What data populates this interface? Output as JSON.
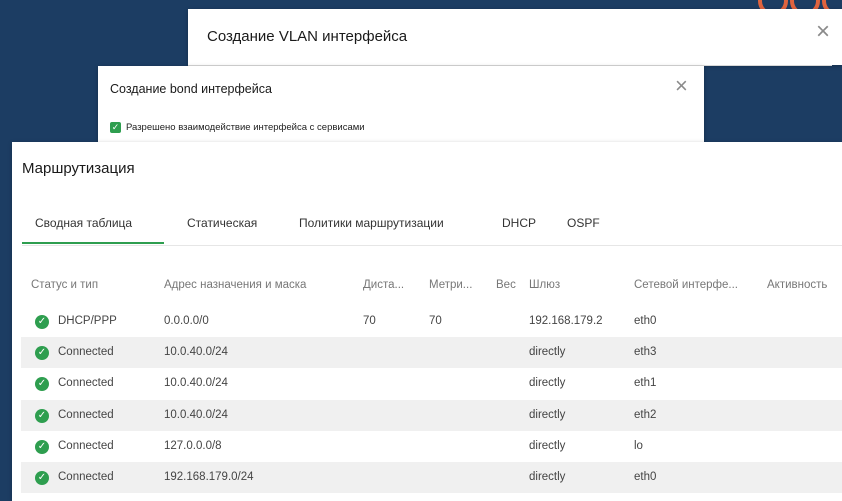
{
  "vlan_dialog": {
    "title": "Создание VLAN интерфейса",
    "close_label": "×"
  },
  "bond_dialog": {
    "title": "Создание bond интерфейса",
    "close_label": "×",
    "checkbox_label": "Разрешено взаимодействие интерфейса с сервисами",
    "checkbox_checked": true
  },
  "routing": {
    "title": "Маршрутизация",
    "tabs": [
      "Сводная таблица",
      "Статическая",
      "Политики маршрутизации",
      "DHCP",
      "OSPF"
    ],
    "active_tab": 0,
    "columns": [
      "Статус и тип",
      "Адрес назначения и маска",
      "Диста...",
      "Метри...",
      "Вес",
      "Шлюз",
      "Сетевой интерфе...",
      "Активность"
    ],
    "rows": [
      {
        "type": "DHCP/PPP",
        "dest": "0.0.0.0/0",
        "distance": "70",
        "metric": "70",
        "weight": "",
        "gateway": "192.168.179.2",
        "iface": "eth0",
        "activity": ""
      },
      {
        "type": "Connected",
        "dest": "10.0.40.0/24",
        "distance": "",
        "metric": "",
        "weight": "",
        "gateway": "directly",
        "iface": "eth3",
        "activity": ""
      },
      {
        "type": "Connected",
        "dest": "10.0.40.0/24",
        "distance": "",
        "metric": "",
        "weight": "",
        "gateway": "directly",
        "iface": "eth1",
        "activity": ""
      },
      {
        "type": "Connected",
        "dest": "10.0.40.0/24",
        "distance": "",
        "metric": "",
        "weight": "",
        "gateway": "directly",
        "iface": "eth2",
        "activity": ""
      },
      {
        "type": "Connected",
        "dest": "127.0.0.0/8",
        "distance": "",
        "metric": "",
        "weight": "",
        "gateway": "directly",
        "iface": "lo",
        "activity": ""
      },
      {
        "type": "Connected",
        "dest": "192.168.179.0/24",
        "distance": "",
        "metric": "",
        "weight": "",
        "gateway": "directly",
        "iface": "eth0",
        "activity": ""
      }
    ]
  },
  "icons": {
    "status": "check-circle-icon",
    "close": "close-icon",
    "checkbox": "checkbox-checked-icon"
  },
  "colors": {
    "accent": "#2e9e4f",
    "background": "#1c3d63",
    "decoration": "#e0643f"
  }
}
